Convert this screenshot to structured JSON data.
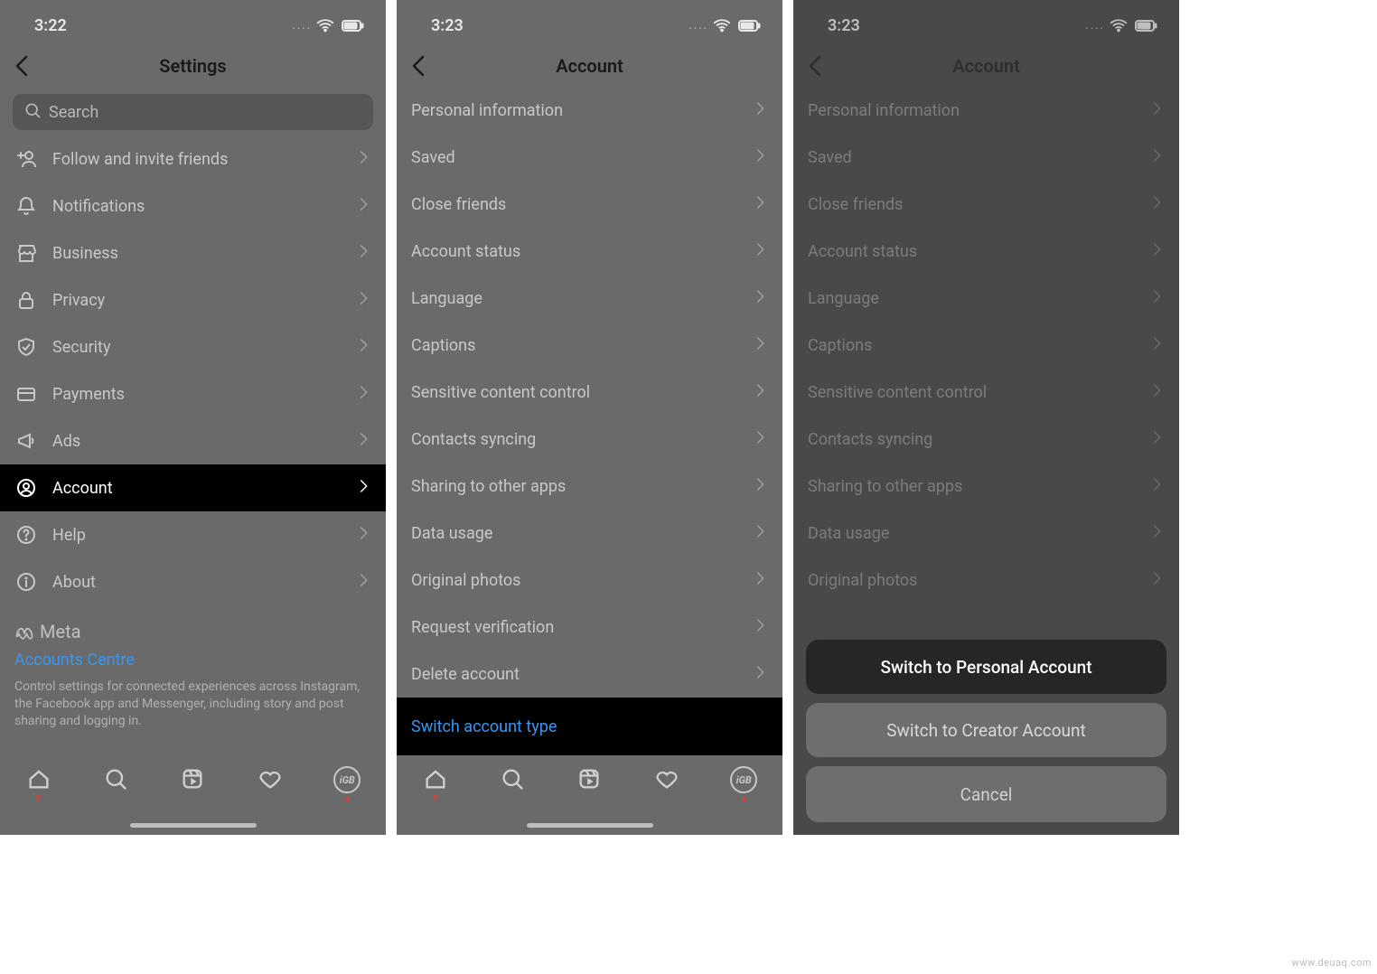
{
  "watermark": "www.deuaq.com",
  "screens": [
    {
      "status": {
        "time": "3:22"
      },
      "header": {
        "title": "Settings"
      },
      "search": {
        "placeholder": "Search"
      },
      "items": [
        {
          "icon": "user-plus-icon",
          "label": "Follow and invite friends"
        },
        {
          "icon": "bell-icon",
          "label": "Notifications"
        },
        {
          "icon": "storefront-icon",
          "label": "Business"
        },
        {
          "icon": "lock-icon",
          "label": "Privacy"
        },
        {
          "icon": "shield-icon",
          "label": "Security"
        },
        {
          "icon": "card-icon",
          "label": "Payments"
        },
        {
          "icon": "megaphone-icon",
          "label": "Ads"
        },
        {
          "icon": "person-circle-icon",
          "label": "Account",
          "highlight": true
        },
        {
          "icon": "help-circle-icon",
          "label": "Help"
        },
        {
          "icon": "info-circle-icon",
          "label": "About"
        }
      ],
      "meta": {
        "brand": "Meta",
        "link": "Accounts Centre",
        "desc": "Control settings for connected experiences across Instagram, the Facebook app and Messenger, including story and post sharing and logging in."
      }
    },
    {
      "status": {
        "time": "3:23"
      },
      "header": {
        "title": "Account"
      },
      "items": [
        {
          "label": "Personal information"
        },
        {
          "label": "Saved"
        },
        {
          "label": "Close friends"
        },
        {
          "label": "Account status"
        },
        {
          "label": "Language"
        },
        {
          "label": "Captions"
        },
        {
          "label": "Sensitive content control"
        },
        {
          "label": "Contacts syncing"
        },
        {
          "label": "Sharing to other apps"
        },
        {
          "label": "Data usage"
        },
        {
          "label": "Original photos"
        },
        {
          "label": "Request verification"
        },
        {
          "label": "Delete account"
        },
        {
          "label": "Switch account type",
          "link_blue": true
        }
      ]
    },
    {
      "status": {
        "time": "3:23"
      },
      "header": {
        "title": "Account"
      },
      "items": [
        {
          "label": "Personal information"
        },
        {
          "label": "Saved"
        },
        {
          "label": "Close friends"
        },
        {
          "label": "Account status"
        },
        {
          "label": "Language"
        },
        {
          "label": "Captions"
        },
        {
          "label": "Sensitive content control"
        },
        {
          "label": "Contacts syncing"
        },
        {
          "label": "Sharing to other apps"
        },
        {
          "label": "Data usage"
        },
        {
          "label": "Original photos"
        }
      ],
      "sheet": {
        "primary": "Switch to Personal Account",
        "secondary": "Switch to Creator Account",
        "cancel": "Cancel"
      }
    }
  ]
}
